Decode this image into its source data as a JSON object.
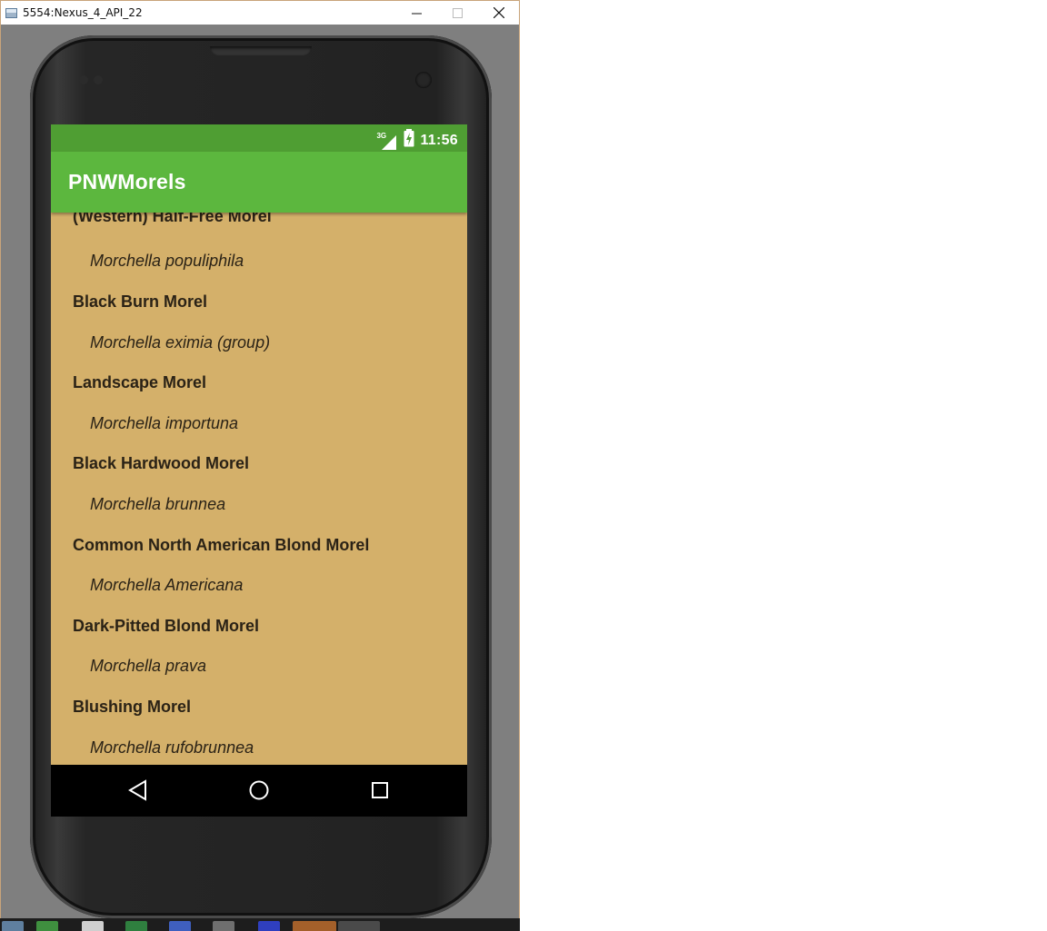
{
  "window": {
    "title": "5554:Nexus_4_API_22"
  },
  "status_bar": {
    "network": "3G",
    "time": "11:56"
  },
  "app_bar": {
    "title": "PNWMorels"
  },
  "morels": [
    {
      "common": "(Western) Half-Free Morel",
      "scientific": "Morchella populiphila"
    },
    {
      "common": "Black Burn Morel",
      "scientific": "Morchella eximia (group)"
    },
    {
      "common": "Landscape Morel",
      "scientific": "Morchella importuna"
    },
    {
      "common": "Black Hardwood Morel",
      "scientific": "Morchella brunnea"
    },
    {
      "common": "Common North American Blond Morel",
      "scientific": "Morchella Americana"
    },
    {
      "common": "Dark-Pitted Blond Morel",
      "scientific": "Morchella prava"
    },
    {
      "common": "Blushing Morel",
      "scientific": "Morchella rufobrunnea"
    }
  ],
  "nav_bar": {
    "back": "back-icon",
    "home": "home-icon",
    "recents": "recents-icon"
  },
  "colors": {
    "status_bar": "#4f9e33",
    "app_bar": "#5cb73e",
    "list_background": "#d4b06a",
    "nav_bar": "#000000"
  }
}
